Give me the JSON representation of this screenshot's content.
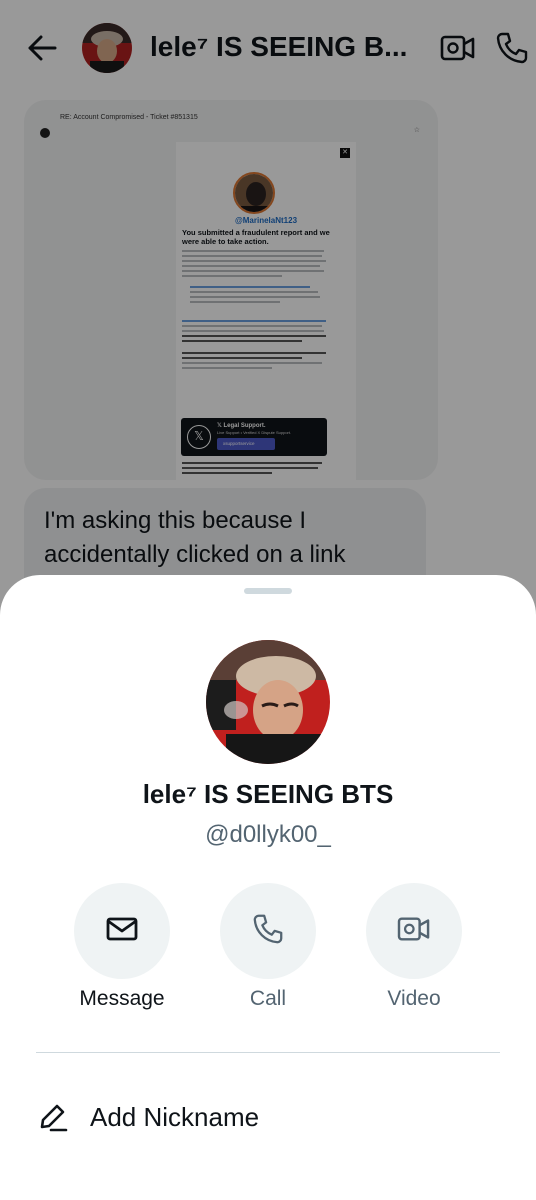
{
  "header": {
    "title": "lele⁷ IS SEEING B...",
    "back_icon": "arrow-left-icon",
    "video_icon": "video-camera-icon",
    "call_icon": "phone-icon"
  },
  "conversation": {
    "email_screenshot": {
      "subject": "RE: Account Compromised - Ticket #851315",
      "handle": "@MarinelaNt123",
      "heading": "You submitted a fraudulent report and we were able to take action.",
      "banner_title": "𝕏 Legal Support.",
      "banner_subtitle": "Live Support • Verified X Dispute Support.",
      "banner_button": "xsupportservice"
    },
    "message_text": "I'm asking this because I accidentally clicked on a link"
  },
  "sheet": {
    "name": "lele⁷ IS SEEING BTS",
    "username": "@d0llyk00_",
    "actions": [
      {
        "label": "Message",
        "icon": "envelope-icon"
      },
      {
        "label": "Call",
        "icon": "phone-icon"
      },
      {
        "label": "Video",
        "icon": "video-camera-icon"
      }
    ],
    "options": [
      {
        "label": "Add Nickname",
        "icon": "pencil-icon"
      }
    ]
  },
  "colors": {
    "text_primary": "#0f1419",
    "text_secondary": "#536471",
    "action_bg": "#eff3f4",
    "overlay": "rgba(0,0,0,0.40)"
  }
}
